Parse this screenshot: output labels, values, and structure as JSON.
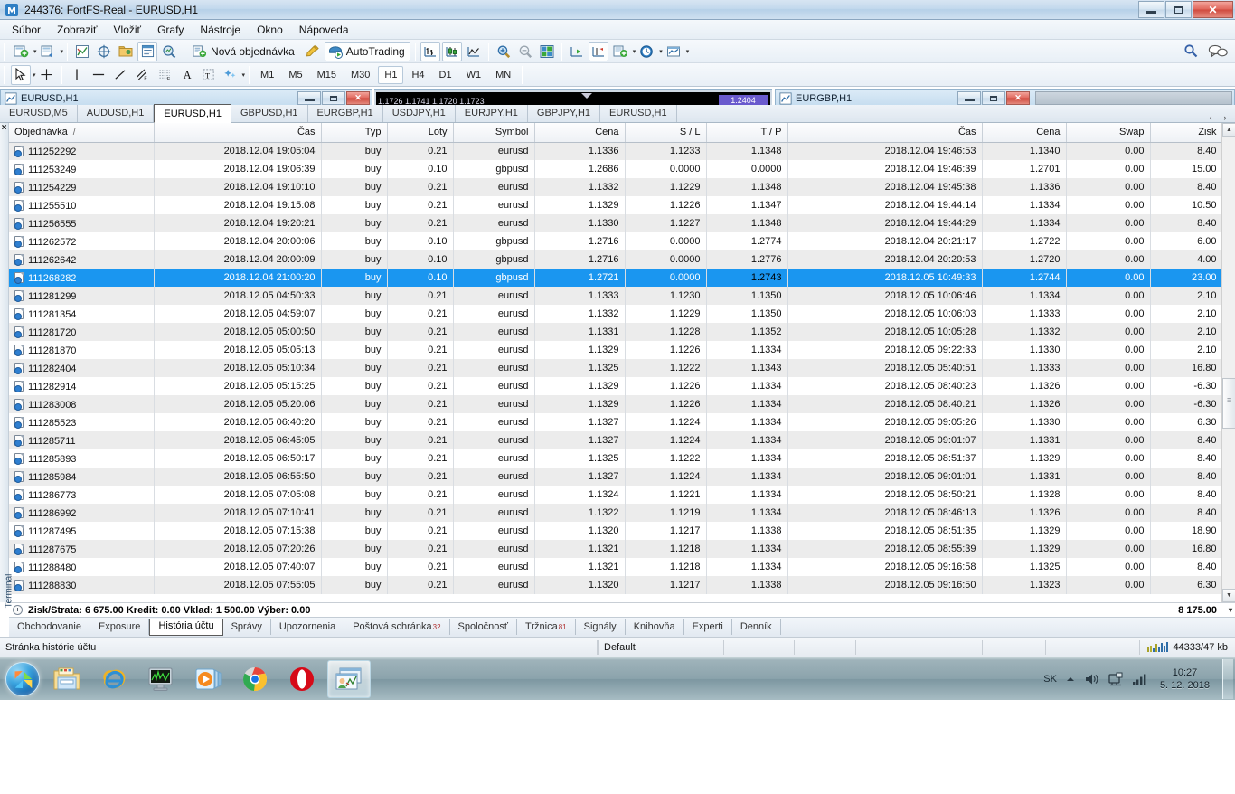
{
  "window": {
    "title": "244376: FortFS-Real - EURUSD,H1",
    "icon": "metatrader-icon",
    "minimize": "minimize",
    "maximize": "maximize",
    "close": "close"
  },
  "menu": [
    "Súbor",
    "Zobraziť",
    "Vložiť",
    "Grafy",
    "Nástroje",
    "Okno",
    "Nápoveda"
  ],
  "toolbar": {
    "new_chart": "new-chart-icon",
    "profiles": "profiles-icon",
    "market_watch": "market-watch-icon",
    "data_window": "data-window-icon",
    "navigator": "navigator-icon",
    "terminal": "terminal-icon",
    "strategy_tester": "strategy-tester-icon",
    "new_order_label": "Nová objednávka",
    "metaeditor": "metaeditor-icon",
    "autotrading_label": "AutoTrading",
    "bar_chart": "bar-chart-icon",
    "candlestick_chart": "candlestick-chart-icon",
    "line_chart": "line-chart-icon",
    "zoom_in": "zoom-in-icon",
    "zoom_out": "zoom-out-icon",
    "tile_windows": "tile-windows-icon",
    "chart_shift": "chart-shift-icon",
    "auto_scroll": "auto-scroll-icon",
    "indicators": "indicators-icon",
    "periods": "periods-clock-icon",
    "templates": "templates-icon",
    "search": "search-icon",
    "chat": "chat-icon"
  },
  "toolbar2": {
    "cursor": "cursor-icon",
    "crosshair": "crosshair-icon",
    "vline": "vertical-line-icon",
    "hline": "horizontal-line-icon",
    "trendline": "trendline-icon",
    "equidistant": "equidistant-channel-icon",
    "fibonacci": "fibonacci-icon",
    "text_a": "text-icon",
    "text_label": "text-label-icon",
    "shapes": "shapes-icon",
    "timeframes": [
      "M1",
      "M5",
      "M15",
      "M30",
      "H1",
      "H4",
      "D1",
      "W1",
      "MN"
    ],
    "active_timeframe": "H1"
  },
  "chart_windows": {
    "left": {
      "title": "EURUSD,H1",
      "band_text": "1.1726 1.1741 1.1720 1.1723",
      "price_tag": "1.2404"
    },
    "right": {
      "title": "EURGBP,H1"
    }
  },
  "chart_tabs": {
    "items": [
      "EURUSD,M5",
      "AUDUSD,H1",
      "EURUSD,H1",
      "GBPUSD,H1",
      "EURGBP,H1",
      "USDJPY,H1",
      "EURJPY,H1",
      "GBPJPY,H1",
      "EURUSD,H1"
    ],
    "active_index": 2,
    "nav_prev": "‹",
    "nav_next": "›"
  },
  "table": {
    "columns": [
      "Objednávka",
      "Čas",
      "Typ",
      "Loty",
      "Symbol",
      "Cena",
      "S / L",
      "T / P",
      "Čas",
      "Cena",
      "Swap",
      "Zisk"
    ],
    "sort_marker": "/",
    "selected_row_index": 7,
    "green_cell": {
      "row": 7,
      "column": 7
    },
    "rows": [
      [
        "111252292",
        "2018.12.04 19:05:04",
        "buy",
        "0.21",
        "eurusd",
        "1.1336",
        "1.1233",
        "1.1348",
        "2018.12.04 19:46:53",
        "1.1340",
        "0.00",
        "8.40"
      ],
      [
        "111253249",
        "2018.12.04 19:06:39",
        "buy",
        "0.10",
        "gbpusd",
        "1.2686",
        "0.0000",
        "0.0000",
        "2018.12.04 19:46:39",
        "1.2701",
        "0.00",
        "15.00"
      ],
      [
        "111254229",
        "2018.12.04 19:10:10",
        "buy",
        "0.21",
        "eurusd",
        "1.1332",
        "1.1229",
        "1.1348",
        "2018.12.04 19:45:38",
        "1.1336",
        "0.00",
        "8.40"
      ],
      [
        "111255510",
        "2018.12.04 19:15:08",
        "buy",
        "0.21",
        "eurusd",
        "1.1329",
        "1.1226",
        "1.1347",
        "2018.12.04 19:44:14",
        "1.1334",
        "0.00",
        "10.50"
      ],
      [
        "111256555",
        "2018.12.04 19:20:21",
        "buy",
        "0.21",
        "eurusd",
        "1.1330",
        "1.1227",
        "1.1348",
        "2018.12.04 19:44:29",
        "1.1334",
        "0.00",
        "8.40"
      ],
      [
        "111262572",
        "2018.12.04 20:00:06",
        "buy",
        "0.10",
        "gbpusd",
        "1.2716",
        "0.0000",
        "1.2774",
        "2018.12.04 20:21:17",
        "1.2722",
        "0.00",
        "6.00"
      ],
      [
        "111262642",
        "2018.12.04 20:00:09",
        "buy",
        "0.10",
        "gbpusd",
        "1.2716",
        "0.0000",
        "1.2776",
        "2018.12.04 20:20:53",
        "1.2720",
        "0.00",
        "4.00"
      ],
      [
        "111268282",
        "2018.12.04 21:00:20",
        "buy",
        "0.10",
        "gbpusd",
        "1.2721",
        "0.0000",
        "1.2743",
        "2018.12.05 10:49:33",
        "1.2744",
        "0.00",
        "23.00"
      ],
      [
        "111281299",
        "2018.12.05 04:50:33",
        "buy",
        "0.21",
        "eurusd",
        "1.1333",
        "1.1230",
        "1.1350",
        "2018.12.05 10:06:46",
        "1.1334",
        "0.00",
        "2.10"
      ],
      [
        "111281354",
        "2018.12.05 04:59:07",
        "buy",
        "0.21",
        "eurusd",
        "1.1332",
        "1.1229",
        "1.1350",
        "2018.12.05 10:06:03",
        "1.1333",
        "0.00",
        "2.10"
      ],
      [
        "111281720",
        "2018.12.05 05:00:50",
        "buy",
        "0.21",
        "eurusd",
        "1.1331",
        "1.1228",
        "1.1352",
        "2018.12.05 10:05:28",
        "1.1332",
        "0.00",
        "2.10"
      ],
      [
        "111281870",
        "2018.12.05 05:05:13",
        "buy",
        "0.21",
        "eurusd",
        "1.1329",
        "1.1226",
        "1.1334",
        "2018.12.05 09:22:33",
        "1.1330",
        "0.00",
        "2.10"
      ],
      [
        "111282404",
        "2018.12.05 05:10:34",
        "buy",
        "0.21",
        "eurusd",
        "1.1325",
        "1.1222",
        "1.1343",
        "2018.12.05 05:40:51",
        "1.1333",
        "0.00",
        "16.80"
      ],
      [
        "111282914",
        "2018.12.05 05:15:25",
        "buy",
        "0.21",
        "eurusd",
        "1.1329",
        "1.1226",
        "1.1334",
        "2018.12.05 08:40:23",
        "1.1326",
        "0.00",
        "-6.30"
      ],
      [
        "111283008",
        "2018.12.05 05:20:06",
        "buy",
        "0.21",
        "eurusd",
        "1.1329",
        "1.1226",
        "1.1334",
        "2018.12.05 08:40:21",
        "1.1326",
        "0.00",
        "-6.30"
      ],
      [
        "111285523",
        "2018.12.05 06:40:20",
        "buy",
        "0.21",
        "eurusd",
        "1.1327",
        "1.1224",
        "1.1334",
        "2018.12.05 09:05:26",
        "1.1330",
        "0.00",
        "6.30"
      ],
      [
        "111285711",
        "2018.12.05 06:45:05",
        "buy",
        "0.21",
        "eurusd",
        "1.1327",
        "1.1224",
        "1.1334",
        "2018.12.05 09:01:07",
        "1.1331",
        "0.00",
        "8.40"
      ],
      [
        "111285893",
        "2018.12.05 06:50:17",
        "buy",
        "0.21",
        "eurusd",
        "1.1325",
        "1.1222",
        "1.1334",
        "2018.12.05 08:51:37",
        "1.1329",
        "0.00",
        "8.40"
      ],
      [
        "111285984",
        "2018.12.05 06:55:50",
        "buy",
        "0.21",
        "eurusd",
        "1.1327",
        "1.1224",
        "1.1334",
        "2018.12.05 09:01:01",
        "1.1331",
        "0.00",
        "8.40"
      ],
      [
        "111286773",
        "2018.12.05 07:05:08",
        "buy",
        "0.21",
        "eurusd",
        "1.1324",
        "1.1221",
        "1.1334",
        "2018.12.05 08:50:21",
        "1.1328",
        "0.00",
        "8.40"
      ],
      [
        "111286992",
        "2018.12.05 07:10:41",
        "buy",
        "0.21",
        "eurusd",
        "1.1322",
        "1.1219",
        "1.1334",
        "2018.12.05 08:46:13",
        "1.1326",
        "0.00",
        "8.40"
      ],
      [
        "111287495",
        "2018.12.05 07:15:38",
        "buy",
        "0.21",
        "eurusd",
        "1.1320",
        "1.1217",
        "1.1338",
        "2018.12.05 08:51:35",
        "1.1329",
        "0.00",
        "18.90"
      ],
      [
        "111287675",
        "2018.12.05 07:20:26",
        "buy",
        "0.21",
        "eurusd",
        "1.1321",
        "1.1218",
        "1.1334",
        "2018.12.05 08:55:39",
        "1.1329",
        "0.00",
        "16.80"
      ],
      [
        "111288480",
        "2018.12.05 07:40:07",
        "buy",
        "0.21",
        "eurusd",
        "1.1321",
        "1.1218",
        "1.1334",
        "2018.12.05 09:16:58",
        "1.1325",
        "0.00",
        "8.40"
      ],
      [
        "111288830",
        "2018.12.05 07:55:05",
        "buy",
        "0.21",
        "eurusd",
        "1.1320",
        "1.1217",
        "1.1338",
        "2018.12.05 09:16:50",
        "1.1323",
        "0.00",
        "6.30"
      ]
    ]
  },
  "summary": {
    "text": "Zisk/Strata: 6 675.00  Kredit: 0.00  Vklad: 1 500.00  Výber: 0.00",
    "total": "8 175.00"
  },
  "terminal": {
    "vertical_label": "Terminál",
    "close_label": "×",
    "tabs": [
      {
        "label": "Obchodovanie",
        "badge": ""
      },
      {
        "label": "Exposure",
        "badge": ""
      },
      {
        "label": "História účtu",
        "badge": ""
      },
      {
        "label": "Správy",
        "badge": ""
      },
      {
        "label": "Upozornenia",
        "badge": ""
      },
      {
        "label": "Poštová schránka",
        "badge": "32"
      },
      {
        "label": "Spoločnosť",
        "badge": ""
      },
      {
        "label": "Tržnica",
        "badge": "81"
      },
      {
        "label": "Signály",
        "badge": ""
      },
      {
        "label": "Knihovňa",
        "badge": ""
      },
      {
        "label": "Experti",
        "badge": ""
      },
      {
        "label": "Denník",
        "badge": ""
      }
    ],
    "active_tab_index": 2
  },
  "statusbar": {
    "hint": "Stránka histórie účtu",
    "profile": "Default",
    "traffic": "44333/47 kb"
  },
  "taskbar": {
    "start": "windows-start-orb",
    "apps": [
      "file-explorer-icon",
      "internet-explorer-icon",
      "resource-monitor-icon",
      "windows-media-player-icon",
      "google-chrome-icon",
      "opera-icon",
      "metatrader-icon"
    ],
    "active_app_index": 6,
    "language": "SK",
    "tray": [
      "show-hidden-icons",
      "volume-icon",
      "network-icon",
      "signal-icon"
    ],
    "clock_time": "10:27",
    "clock_date": "5. 12. 2018"
  },
  "colors": {
    "selection": "#1a96f0",
    "tp_highlight": "#39e639",
    "titlebar": "#c3d9ed",
    "alt_row": "#ececec",
    "badge": "#b03030"
  }
}
